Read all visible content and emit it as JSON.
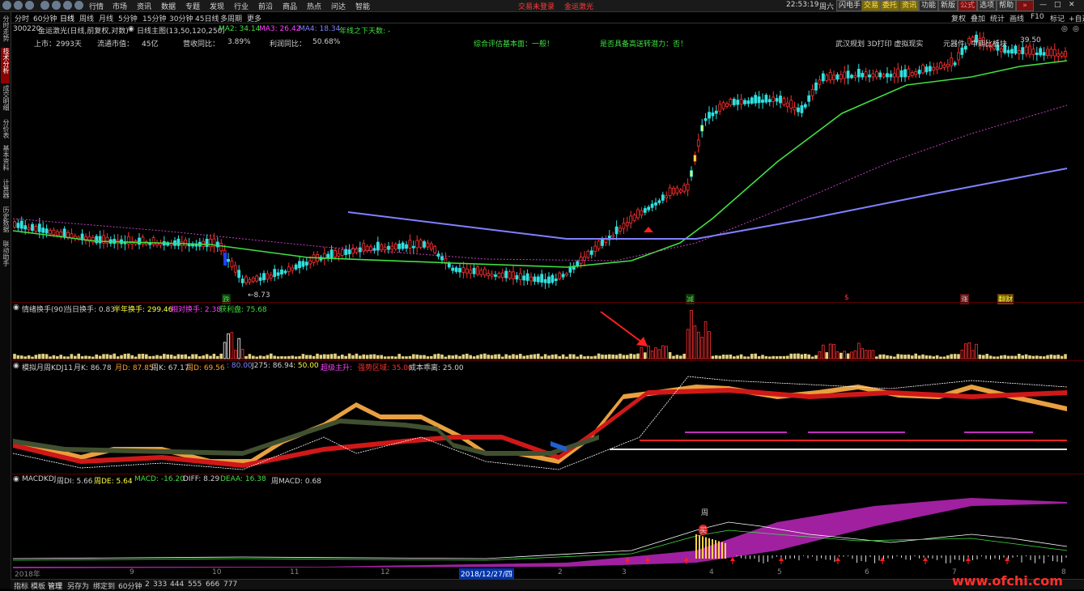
{
  "menu": {
    "items": [
      "行情",
      "市场",
      "资讯",
      "数据",
      "专题",
      "发现",
      "行业",
      "前沿",
      "商品",
      "热点",
      "问达",
      "智能"
    ],
    "notice": "交易未登录",
    "stock_name": "金运激光",
    "time": "22:53:19",
    "weekday": "周六",
    "tools": [
      "闪电手",
      "交易",
      "委托",
      "资讯",
      "功能",
      "新版",
      "公式",
      "选项",
      "帮助"
    ]
  },
  "tabs": {
    "items": [
      "分时",
      "60分钟",
      "日线",
      "周线",
      "月线",
      "5分钟",
      "15分钟",
      "30分钟",
      "45日线",
      "多周期",
      "更多"
    ],
    "active": "日线",
    "right": [
      "复权",
      "叠加",
      "统计",
      "画线",
      "F10",
      "标记",
      "+自选"
    ]
  },
  "sidebar": [
    "分时走势",
    "技术分析",
    "成交明细",
    "分价表",
    "基本资料",
    "计算器",
    "历史数据",
    "联动助手"
  ],
  "header": {
    "code": "300220",
    "name": "金运激光(日线,前复权,对数)",
    "main": "日线主图(13,50,120,250)",
    "ma2": "MA2: 34.14",
    "ma3": "MA3: 26.42",
    "ma4": "MA4: 18.34",
    "extra": "年线之下天数: -"
  },
  "fundamentals": {
    "listed": "上市：2993天",
    "mcap_label": "流通市值：",
    "mcap": "45亿",
    "rev_label": "营收同比：",
    "rev": "3.89%",
    "profit_label": "利润同比：",
    "profit": "50.68%",
    "rating": "综合评估基本面：一般！",
    "potential": "是否具备高送转潜力：否！",
    "concepts": "武汉规划 3D打印 虚拟现实",
    "sector": "元器件",
    "sector_extra": "中期比板块",
    "price_right": "39.50"
  },
  "annotations": {
    "low": "←8.73",
    "tag1": "跌",
    "tag2": "减",
    "tag3": "$",
    "tag4": "涨",
    "tag5": "翻财"
  },
  "panel1": {
    "title": "情绪换手(90)",
    "a": "当日换手: 0.83",
    "b": "半年换手: 299.46",
    "c": "相对换手: 2.38",
    "d": "获利盘: 75.68"
  },
  "panel2": {
    "title": "模拟月周KDJ11",
    "a": "月K: 86.78",
    "b": "月D: 87.85",
    "c": "周K: 67.17",
    "d": "周D: 69.56",
    "e": ": 80.00",
    "f": "J275: 86.94",
    "g": ": 50.00",
    "h": "超级主升: ",
    "i": "强势区域: 35.00",
    "j": "成本乖离: 25.00"
  },
  "panel3": {
    "title": "MACDKDJ",
    "a": "周DI: 5.66",
    "b": "周DE: 5.64",
    "c": "MACD: -16.20",
    "d": "DIFF: 8.29",
    "e": "DEAA: 16.38",
    "f": "周MACD: 0.68",
    "zhou": "周",
    "bu": "买"
  },
  "xaxis": {
    "labels": [
      "2018年",
      "9",
      "10",
      "11",
      "12",
      "2018/12/27/四",
      "2",
      "3",
      "4",
      "5",
      "6",
      "7",
      "8"
    ]
  },
  "bottom": {
    "items": [
      "指标",
      "模板",
      "管理",
      "另存为",
      "绑定到",
      "60分钟",
      "2",
      "333",
      "444",
      "555",
      "666",
      "777"
    ]
  },
  "watermark": "www.ofchi.com",
  "colors": {
    "up": "#ff3030",
    "down": "#30e0e0",
    "ma2": "#40e040",
    "ma3": "#ff40ff",
    "ma4": "#8080ff",
    "accent": "#8b0000"
  }
}
